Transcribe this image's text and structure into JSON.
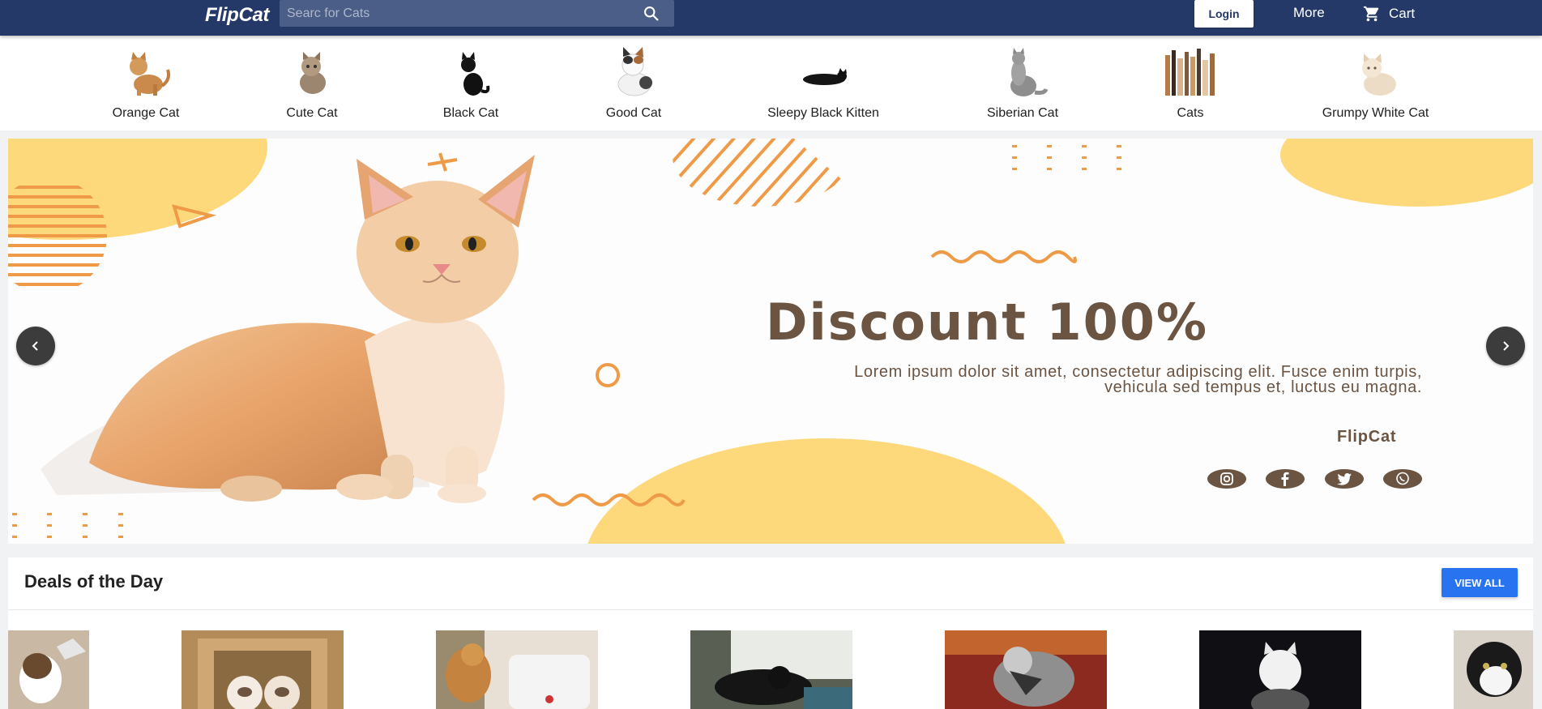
{
  "header": {
    "logo": "FlipCat",
    "search_placeholder": "Searc for Cats",
    "login_label": "Login",
    "more_label": "More",
    "cart_label": "Cart"
  },
  "categories": [
    {
      "label": "Orange Cat",
      "icon": "orange-cat-thumbnail"
    },
    {
      "label": "Cute Cat",
      "icon": "cute-cat-thumbnail"
    },
    {
      "label": "Black Cat",
      "icon": "black-cat-thumbnail"
    },
    {
      "label": "Good Cat",
      "icon": "good-cat-thumbnail"
    },
    {
      "label": "Sleepy Black Kitten",
      "icon": "sleepy-black-kitten-thumbnail"
    },
    {
      "label": "Siberian Cat",
      "icon": "siberian-cat-thumbnail"
    },
    {
      "label": "Cats",
      "icon": "cats-thumbnail"
    },
    {
      "label": "Grumpy White Cat",
      "icon": "grumpy-white-cat-thumbnail"
    }
  ],
  "banner": {
    "title": "Discount 100%",
    "text": "Lorem ipsum dolor sit amet, consectetur adipiscing elit. Fusce enim turpis, vehicula sed tempus et, luctus eu magna.",
    "brand": "FlipCat",
    "social_icons": [
      "instagram-icon",
      "facebook-icon",
      "twitter-icon",
      "whatsapp-icon"
    ]
  },
  "deals": {
    "title": "Deals of the Day",
    "view_all_label": "VIEW ALL"
  },
  "colors": {
    "header_bg": "#253968",
    "accent_blue": "#2874f0",
    "banner_yellow": "#fdd97c",
    "banner_orange": "#ef9a46",
    "banner_brown": "#6b5442"
  }
}
